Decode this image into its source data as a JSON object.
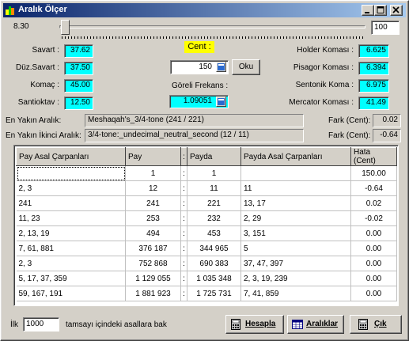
{
  "window": {
    "title": "Aralık Ölçer"
  },
  "slider": {
    "min_label": "8.30",
    "value": "100",
    "fraction": 0.005
  },
  "left": {
    "savart_label": "Savart :",
    "savart": "37.62",
    "duzsavart_label": "Düz.Savart :",
    "duzsavart": "37.50",
    "komac_label": "Komaç :",
    "komac": "45.00",
    "santioktav_label": "Santioktav :",
    "santioktav": "12.50"
  },
  "center": {
    "cent_label": "Cent :",
    "cent_value": "150",
    "oku_label": "Oku",
    "goreli_label": "Göreli Frekans :",
    "goreli_value": "1.09051"
  },
  "right": {
    "holder_label": "Holder Koması :",
    "holder": "6.625",
    "pisagor_label": "Pisagor Koması :",
    "pisagor": "6.394",
    "sentonik_label": "Sentonik Koma :",
    "sentonik": "6.975",
    "mercator_label": "Mercator Koması :",
    "mercator": "41.49"
  },
  "nearest": {
    "label1": "En Yakın Aralık:",
    "value1": "Meshaqah's_3/4-tone (241 / 221)",
    "fark1_label": "Fark (Cent):",
    "fark1": "0.02",
    "label2": "En Yakın İkinci Aralık:",
    "value2": "3/4-tone:_undecimal_neutral_second (12 / 11)",
    "fark2_label": "Fark (Cent):",
    "fark2": "-0.64"
  },
  "grid": {
    "headers": [
      "Pay Asal Çarpanları",
      "Pay",
      ":",
      "Payda",
      "Payda Asal Çarpanları",
      "Hata (Cent)"
    ],
    "rows": [
      [
        "",
        "1",
        ":",
        "1",
        "",
        "150.00"
      ],
      [
        "2, 3",
        "12",
        ":",
        "11",
        "11",
        "-0.64"
      ],
      [
        "241",
        "241",
        ":",
        "221",
        "13, 17",
        "0.02"
      ],
      [
        "11, 23",
        "253",
        ":",
        "232",
        "2, 29",
        "-0.02"
      ],
      [
        "2, 13, 19",
        "494",
        ":",
        "453",
        "3, 151",
        "0.00"
      ],
      [
        "7, 61, 881",
        "376 187",
        ":",
        "344 965",
        "5",
        "0.00"
      ],
      [
        "2, 3",
        "752 868",
        ":",
        "690 383",
        "37, 47, 397",
        "0.00"
      ],
      [
        "5, 17, 37, 359",
        "1 129 055",
        ":",
        "1 035 348",
        "2, 3, 19, 239",
        "0.00"
      ],
      [
        "59, 167, 191",
        "1 881 923",
        ":",
        "1 725 731",
        "7, 41, 859",
        "0.00"
      ]
    ]
  },
  "footer": {
    "ilk_label": "İlk",
    "ilk_value": "1000",
    "tail": "tamsayı içindeki asallara bak",
    "hesapla": "Hesapla",
    "araliklar": "Aralıklar",
    "cik": "Çık"
  }
}
